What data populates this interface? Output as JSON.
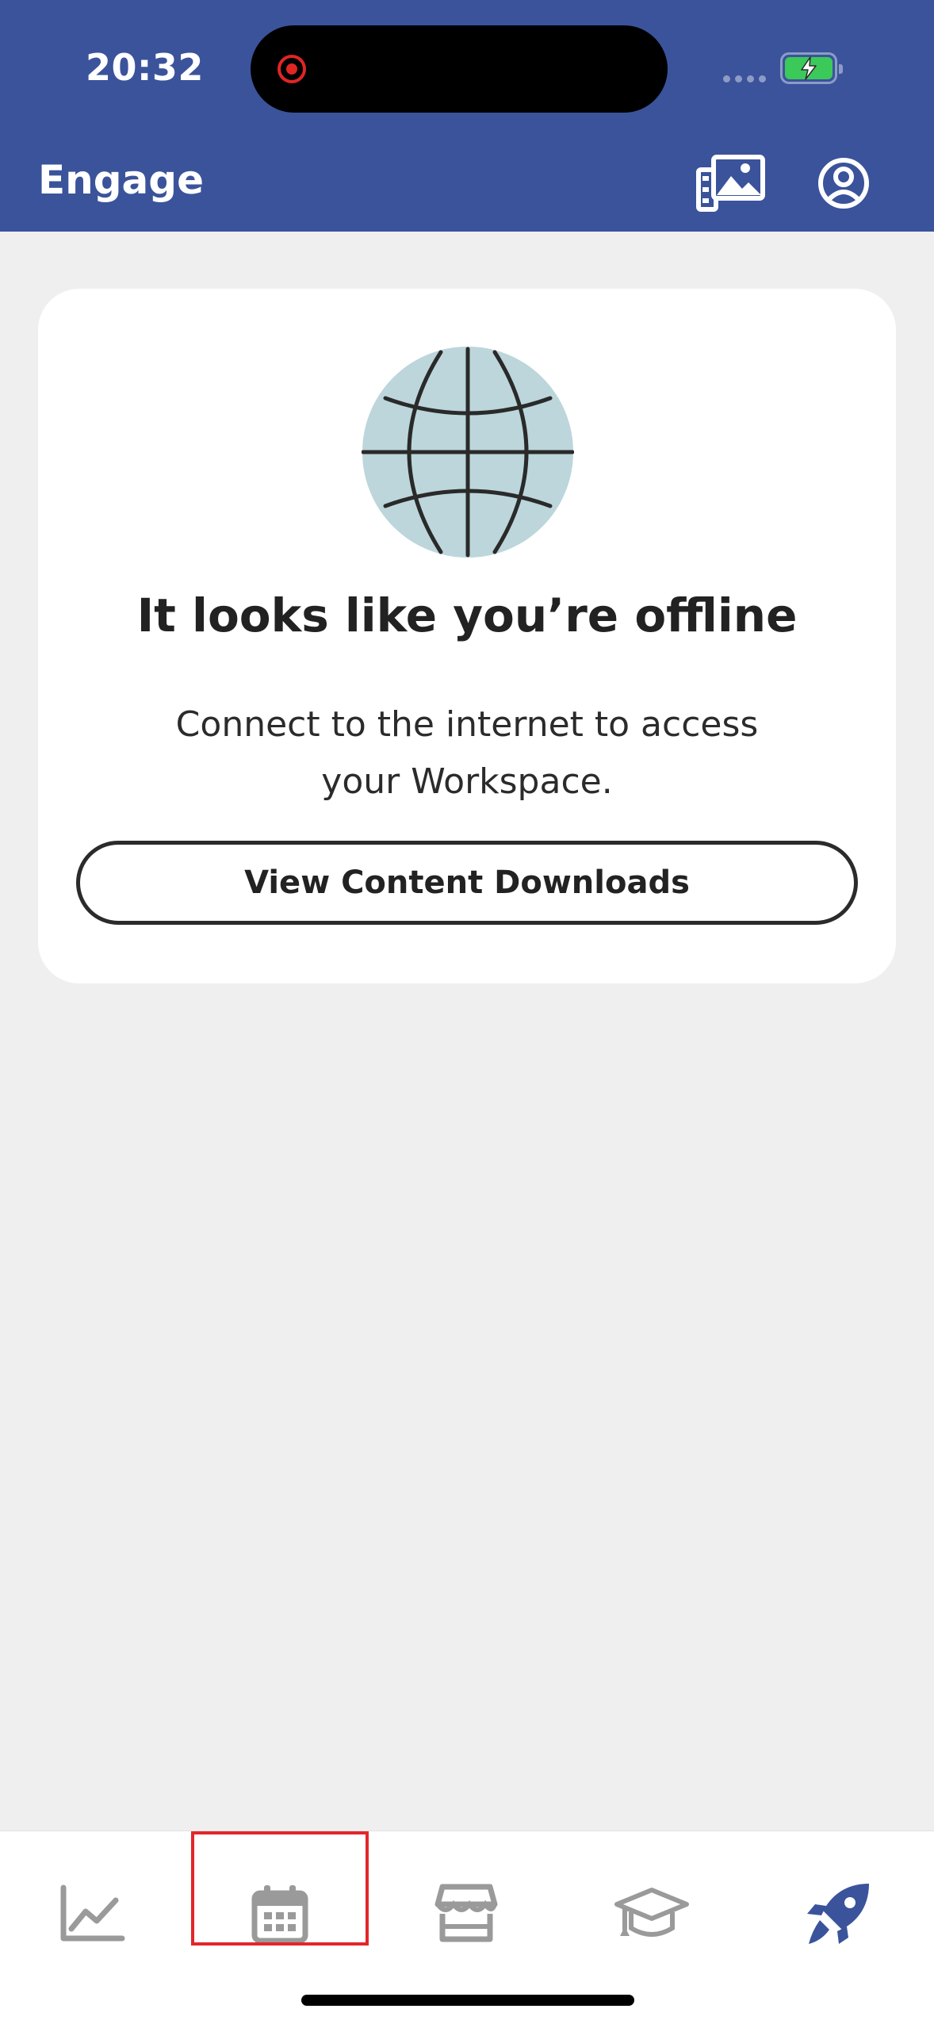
{
  "status_bar": {
    "time": "20:32"
  },
  "header": {
    "title": "Engage"
  },
  "offline_card": {
    "title": "It looks like you’re offline",
    "message": "Connect to the internet to access your Workspace.",
    "button_label": "View Content Downloads"
  },
  "tab_bar": {
    "tabs": [
      {
        "icon": "chart-line-icon",
        "active": false
      },
      {
        "icon": "calendar-icon",
        "active": false,
        "highlighted": true
      },
      {
        "icon": "storefront-icon",
        "active": false
      },
      {
        "icon": "graduation-cap-icon",
        "active": false
      },
      {
        "icon": "rocket-icon",
        "active": true
      }
    ]
  },
  "colors": {
    "header_bg": "#3a539b",
    "active_tab": "#3a539b",
    "inactive_tab": "#9a9a9a",
    "highlight_box": "#e3262b",
    "battery_fill": "#3bc95a"
  }
}
